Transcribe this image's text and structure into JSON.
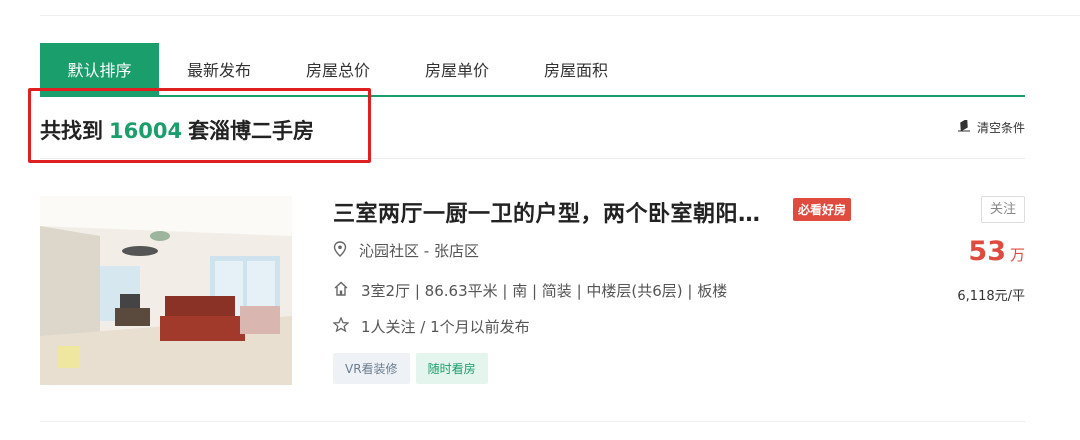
{
  "tabs": [
    {
      "label": "默认排序",
      "active": true
    },
    {
      "label": "最新发布",
      "active": false
    },
    {
      "label": "房屋总价",
      "active": false
    },
    {
      "label": "房屋单价",
      "active": false
    },
    {
      "label": "房屋面积",
      "active": false
    }
  ],
  "result": {
    "prefix": "共找到",
    "count": "16004",
    "suffix": "套淄博二手房",
    "clear_label": "清空条件"
  },
  "listing": {
    "title": "三室两厅一厨一卫的户型，两个卧室朝阳…",
    "badge": "必看好房",
    "community": "沁园社区 - 张店区",
    "house_info": "3室2厅 | 86.63平米 | 南 | 简装 | 中楼层(共6层) | 板楼",
    "follow_info": "1人关注 / 1个月以前发布",
    "tags": [
      "VR看装修",
      "随时看房"
    ],
    "follow_label": "关注",
    "total_price": "53",
    "price_unit": "万",
    "unit_price": "6,118元/平"
  },
  "colors": {
    "accent": "#1a9e6b",
    "price": "#e04b3f",
    "highlight": "#e02020"
  }
}
